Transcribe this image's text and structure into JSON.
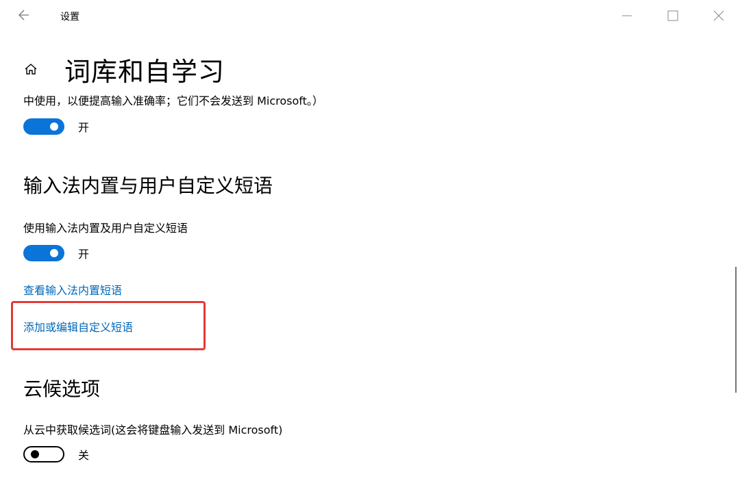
{
  "window": {
    "title": "设置",
    "icons": {
      "back": "back-arrow-icon",
      "minimize": "minimize-icon",
      "maximize": "maximize-icon",
      "close": "close-icon"
    }
  },
  "page": {
    "title": "词库和自学习",
    "home_icon": "home-icon"
  },
  "sections": {
    "self_learning": {
      "description_tail": "中使用，以便提高输入准确率；它们不会发送到 Microsoft。）",
      "toggle": {
        "state": "on",
        "label": "开"
      }
    },
    "phrases": {
      "heading": "输入法内置与用户自定义短语",
      "setting_label": "使用输入法内置及用户自定义短语",
      "toggle": {
        "state": "on",
        "label": "开"
      },
      "link_view": "查看输入法内置短语",
      "link_edit": "添加或编辑自定义短语"
    },
    "cloud": {
      "heading": "云候选项",
      "setting_label": "从云中获取候选词(这会将键盘输入发送到 Microsoft)",
      "toggle": {
        "state": "off",
        "label": "关"
      }
    }
  },
  "colors": {
    "accent": "#0a74d9",
    "link": "#0067b8",
    "highlight": "#e53935"
  }
}
